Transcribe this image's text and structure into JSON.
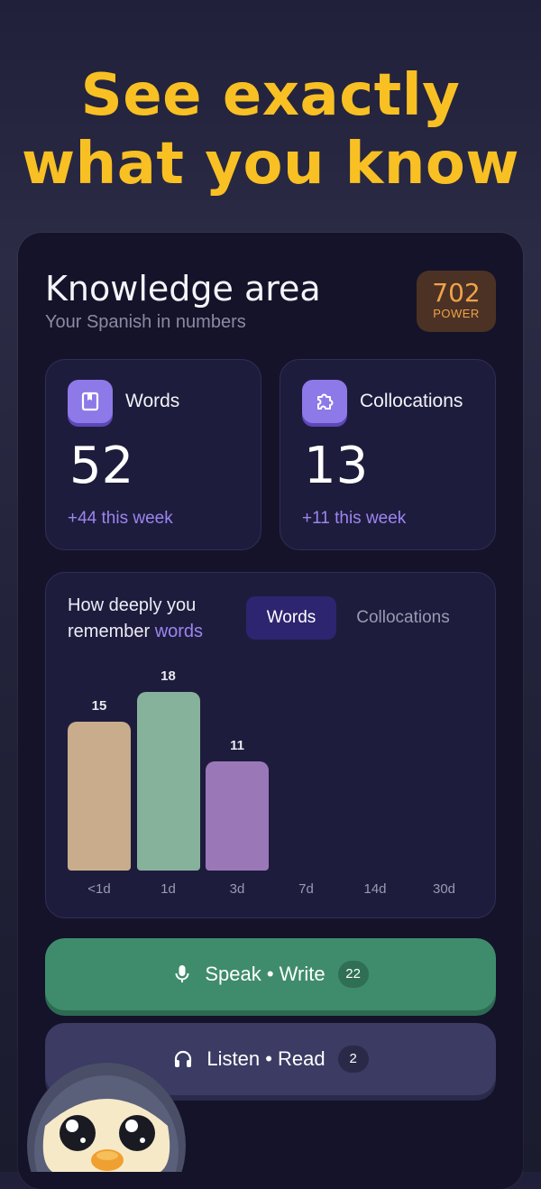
{
  "headline": {
    "line1": "See exactly",
    "line2": "what you know"
  },
  "knowledge": {
    "title": "Knowledge area",
    "subtitle": "Your Spanish in numbers",
    "power_value": "702",
    "power_label": "POWER"
  },
  "stats": [
    {
      "label": "Words",
      "value": "52",
      "delta": "+44 this week",
      "icon": "book-icon"
    },
    {
      "label": "Collocations",
      "value": "13",
      "delta": "+11 this week",
      "icon": "puzzle-icon"
    }
  ],
  "memory": {
    "title_prefix": "How deeply you",
    "title_mid": "remember ",
    "title_accent": "words",
    "tabs": [
      {
        "label": "Words",
        "active": true
      },
      {
        "label": "Collocations",
        "active": false
      }
    ]
  },
  "chart_data": {
    "type": "bar",
    "categories": [
      "<1d",
      "1d",
      "3d",
      "7d",
      "14d",
      "30d"
    ],
    "values": [
      15,
      18,
      11,
      0,
      0,
      0
    ],
    "value_labels": [
      "15",
      "18",
      "11",
      "",
      "",
      ""
    ],
    "colors": [
      "#c9ac8c",
      "#86b29c",
      "#9a78b8"
    ]
  },
  "actions": {
    "speak": {
      "label": "Speak • Write",
      "count": "22",
      "icon": "microphone-icon"
    },
    "listen": {
      "label": "Listen • Read",
      "count": "2",
      "icon": "headphones-icon"
    }
  },
  "colors": {
    "accent_yellow": "#f9c023",
    "purple": "#9b86f0",
    "green_button": "#3f8c6c",
    "orange_power": "#f0a24a"
  }
}
